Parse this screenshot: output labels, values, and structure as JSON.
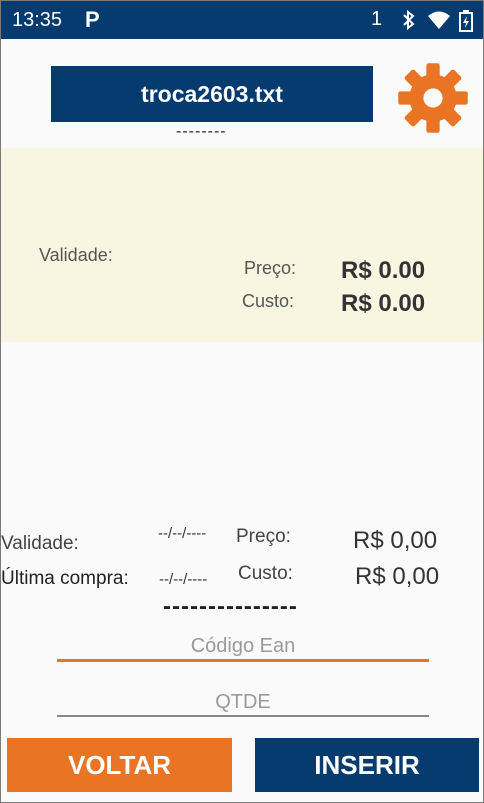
{
  "status_bar": {
    "time": "13:35",
    "app_badge": "P",
    "sim": "1",
    "icons": [
      "bluetooth-icon",
      "wifi-icon",
      "battery-icon"
    ]
  },
  "header": {
    "file_name": "troca2603.txt",
    "settings_icon": "gear-icon",
    "placeholder_dashes": "--------"
  },
  "product_panel": {
    "validade_label": "Validade:",
    "preco_label": "Preço:",
    "preco_value": "R$ 0.00",
    "custo_label": "Custo:",
    "custo_value": "R$ 0.00"
  },
  "last_purchase": {
    "validade_label": "Validade:",
    "validade_value": "--/--/----",
    "ultima_compra_label": "Última compra:",
    "ultima_compra_value": "--/--/----",
    "preco_label": "Preço:",
    "preco_value": "R$ 0,00",
    "custo_label": "Custo:",
    "custo_value": "R$ 0,00",
    "dashes": "---------------"
  },
  "inputs": {
    "ean_placeholder": "Código Ean",
    "qtde_placeholder": "QTDE"
  },
  "buttons": {
    "voltar": "VOLTAR",
    "inserir": "INSERIR"
  },
  "colors": {
    "primary": "#053b6f",
    "accent": "#e87424",
    "panel": "#f8f6e0"
  }
}
